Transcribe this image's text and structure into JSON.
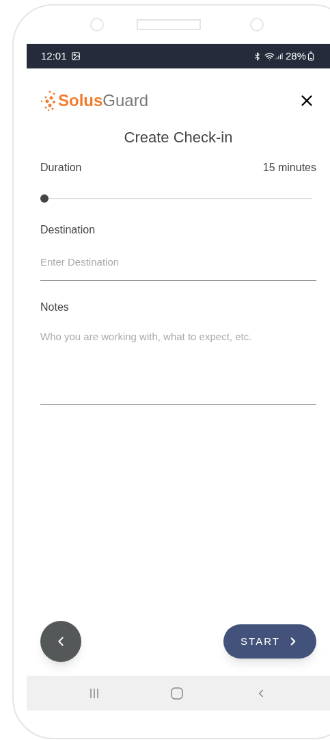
{
  "status_bar": {
    "time": "12:01",
    "battery": "28%"
  },
  "header": {
    "logo_bold": "Solus",
    "logo_light": "Guard"
  },
  "title": "Create Check-in",
  "duration": {
    "label": "Duration",
    "reading": "15 minutes",
    "level": 0
  },
  "destination": {
    "label": "Destination",
    "placeholder": "Enter Destination"
  },
  "notes": {
    "label": "Notes",
    "placeholder": "Who you are working with, what to expect, etc."
  },
  "start_button": {
    "label": "START"
  }
}
